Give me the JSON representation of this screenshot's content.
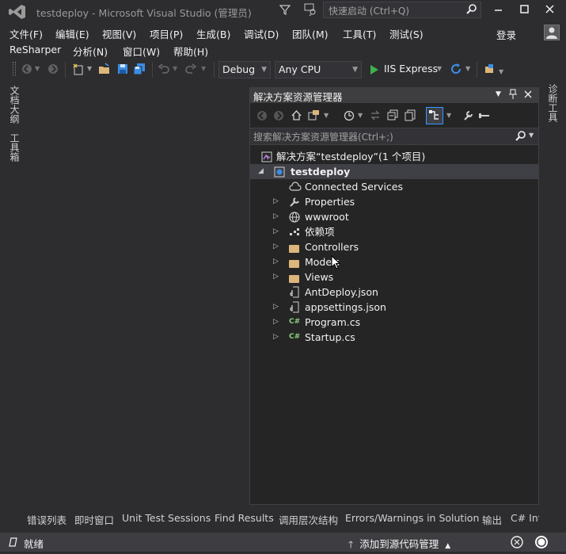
{
  "window": {
    "title": "testdeploy - Microsoft Visual Studio (管理员)",
    "quick_launch_placeholder": "快速启动 (Ctrl+Q)",
    "login": "登录"
  },
  "menu": {
    "row1": [
      "文件(F)",
      "编辑(E)",
      "视图(V)",
      "项目(P)",
      "生成(B)",
      "调试(D)",
      "团队(M)",
      "工具(T)",
      "测试(S)"
    ],
    "row2": [
      "ReSharper",
      "分析(N)",
      "窗口(W)",
      "帮助(H)"
    ]
  },
  "toolbar": {
    "config": "Debug",
    "platform": "Any CPU",
    "run_label": "IIS Express"
  },
  "side_tabs": {
    "left1": "文档大纲",
    "left2": "工具箱",
    "right1": "诊断工具"
  },
  "solution_explorer": {
    "title": "解决方案资源管理器",
    "search_placeholder": "搜索解决方案资源管理器(Ctrl+;)",
    "solution": "解决方案“testdeploy”(1 个项目)",
    "project": "testdeploy",
    "items": [
      "Connected Services",
      "Properties",
      "wwwroot",
      "依赖项",
      "Controllers",
      "Models",
      "Views",
      "AntDeploy.json",
      "appsettings.json",
      "Program.cs",
      "Startup.cs"
    ]
  },
  "bottom_tabs": [
    "错误列表",
    "即时窗口",
    "Unit Test Sessions",
    "Find Results",
    "调用层次结构",
    "Errors/Warnings in Solution",
    "输出",
    "C# Int"
  ],
  "status": {
    "left": "就绪",
    "source_control": "添加到源代码管理"
  },
  "colors": {
    "accent": "#68217a",
    "run_green": "#3eb24a",
    "folder": "#dcb67a",
    "csharp": "#8ecf7f"
  }
}
